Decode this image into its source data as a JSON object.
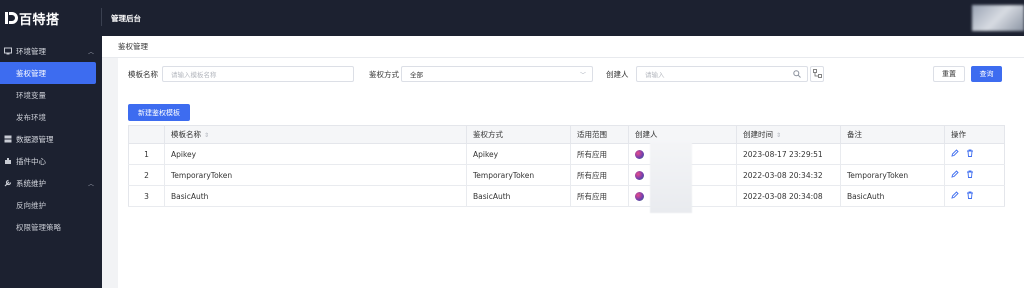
{
  "app": {
    "logo_text": "百特搭",
    "section_title": "管理后台"
  },
  "sidebar": {
    "groups": [
      {
        "label": "环境管理",
        "icon": "monitor-icon",
        "expanded": true,
        "items": [
          {
            "label": "鉴权管理",
            "active": true
          },
          {
            "label": "环境变量"
          },
          {
            "label": "发布环境"
          }
        ]
      },
      {
        "label": "数据源管理",
        "icon": "database-icon"
      },
      {
        "label": "插件中心",
        "icon": "plugin-icon"
      },
      {
        "label": "系统维护",
        "icon": "tools-icon",
        "expanded": true,
        "items": [
          {
            "label": "反向维护"
          },
          {
            "label": "权限管理策略"
          }
        ]
      }
    ]
  },
  "breadcrumb": "鉴权管理",
  "filters": {
    "template_name_label": "模板名称",
    "template_name_placeholder": "请输入模板名称",
    "auth_method_label": "鉴权方式",
    "auth_method_value": "全部",
    "creator_label": "创建人",
    "creator_placeholder": "请输入",
    "reset_label": "重置",
    "query_label": "查询"
  },
  "new_button_label": "新建鉴权模板",
  "table": {
    "columns": [
      "",
      "模板名称",
      "鉴权方式",
      "适用范围",
      "创建人",
      "创建时间",
      "备注",
      "操作"
    ],
    "rows": [
      {
        "index": "1",
        "name": "Apikey",
        "auth": "Apikey",
        "scope": "所有应用",
        "created": "2023-08-17 23:29:51",
        "note": ""
      },
      {
        "index": "2",
        "name": "TemporaryToken",
        "auth": "TemporaryToken",
        "scope": "所有应用",
        "created": "2022-03-08 20:34:32",
        "note": "TemporaryToken"
      },
      {
        "index": "3",
        "name": "BasicAuth",
        "auth": "BasicAuth",
        "scope": "所有应用",
        "created": "2022-03-08 20:34:08",
        "note": "BasicAuth"
      }
    ]
  },
  "colors": {
    "sidebar_bg": "#1c2130",
    "accent": "#3d6cf0",
    "page_bg": "#f2f3f5"
  }
}
